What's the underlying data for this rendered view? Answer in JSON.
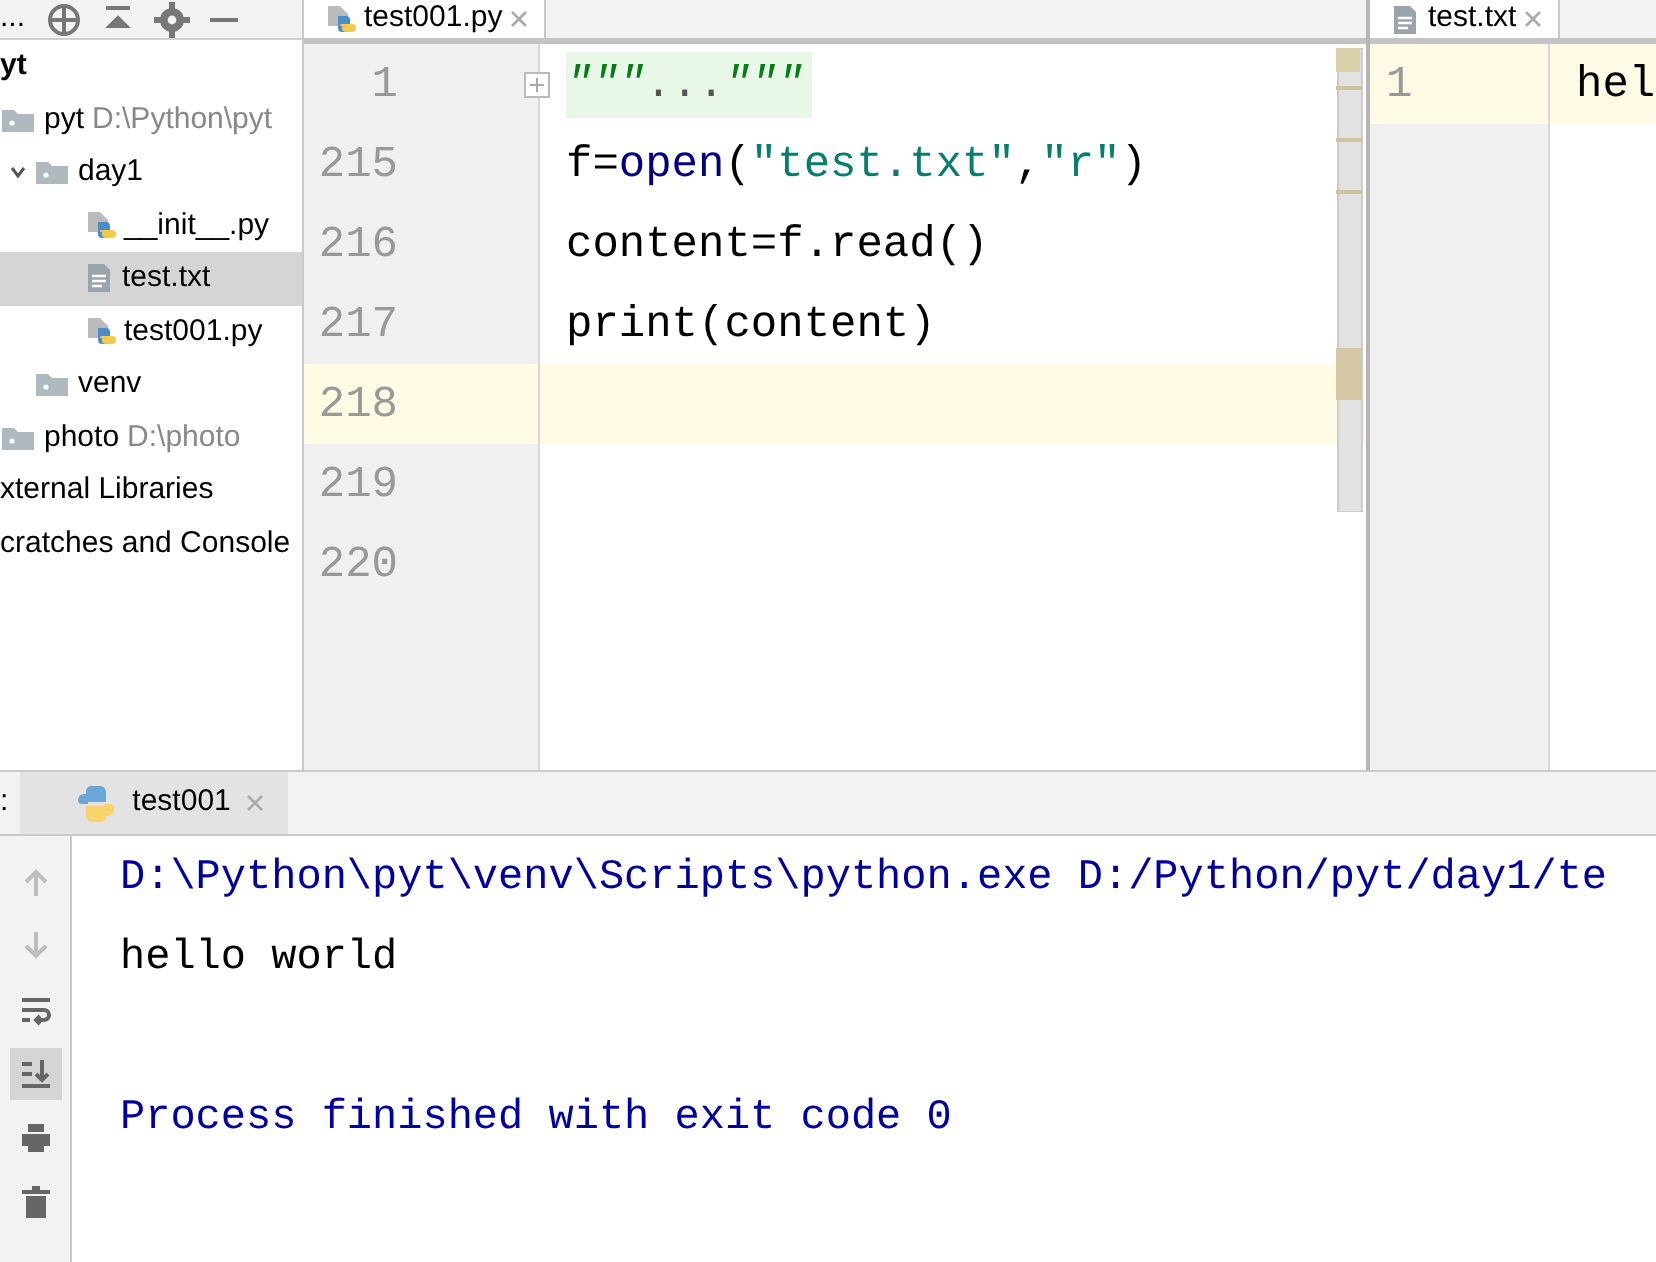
{
  "project_panel": {
    "toolbar_label": "...",
    "tree": [
      {
        "label": "yt",
        "kind": "header",
        "selected": false
      },
      {
        "label": "pyt",
        "path": "D:\\Python\\pyt",
        "kind": "folder",
        "selected": false,
        "children": [
          {
            "label": "day1",
            "kind": "folder",
            "selected": false,
            "children": [
              {
                "label": "__init__.py",
                "kind": "python",
                "selected": false
              },
              {
                "label": "test.txt",
                "kind": "text",
                "selected": true
              },
              {
                "label": "test001.py",
                "kind": "python",
                "selected": false
              }
            ]
          },
          {
            "label": "venv",
            "kind": "folder",
            "selected": false
          }
        ]
      },
      {
        "label": "photo",
        "path": "D:\\photo",
        "kind": "folder",
        "selected": false
      },
      {
        "label": "xternal Libraries",
        "kind": "plain",
        "selected": false
      },
      {
        "label": "cratches and Console",
        "kind": "plain",
        "selected": false
      }
    ]
  },
  "editor": {
    "tab": {
      "label": "test001.py",
      "kind": "python"
    },
    "lines": [
      {
        "number": "1",
        "folded": true,
        "current": false,
        "tokens": [
          {
            "text": "\"\"\"",
            "kind": "doc"
          },
          {
            "text": "...",
            "kind": "fold"
          },
          {
            "text": "\"\"\"",
            "kind": "doc"
          }
        ]
      },
      {
        "number": "215",
        "folded": false,
        "current": false,
        "tokens": [
          {
            "text": "f=",
            "kind": "plain"
          },
          {
            "text": "open",
            "kind": "builtin"
          },
          {
            "text": "(",
            "kind": "plain"
          },
          {
            "text": "\"test.txt\"",
            "kind": "string"
          },
          {
            "text": ",",
            "kind": "plain"
          },
          {
            "text": "\"r\"",
            "kind": "string"
          },
          {
            "text": ")",
            "kind": "plain"
          }
        ]
      },
      {
        "number": "216",
        "folded": false,
        "current": false,
        "tokens": [
          {
            "text": "content=f.read()",
            "kind": "plain"
          }
        ]
      },
      {
        "number": "217",
        "folded": false,
        "current": false,
        "tokens": [
          {
            "text": "print(content)",
            "kind": "plain"
          }
        ]
      },
      {
        "number": "218",
        "folded": false,
        "current": true
      },
      {
        "number": "219",
        "folded": false,
        "current": false
      },
      {
        "number": "220",
        "folded": false,
        "current": false
      }
    ]
  },
  "side_editor": {
    "tab": {
      "label": "test.txt",
      "kind": "text"
    },
    "lines": [
      {
        "number": "1",
        "text": "hel",
        "current": true
      }
    ]
  },
  "run_panel": {
    "label": ":",
    "tab": {
      "label": "test001"
    },
    "tools": [
      {
        "kind": "up",
        "disabled": true,
        "selected": false
      },
      {
        "kind": "down",
        "disabled": true,
        "selected": false
      },
      {
        "kind": "wrap",
        "disabled": false,
        "selected": false
      },
      {
        "kind": "scroll",
        "disabled": false,
        "selected": true
      },
      {
        "kind": "print",
        "disabled": false,
        "selected": false
      },
      {
        "kind": "trash",
        "disabled": false,
        "selected": false
      }
    ],
    "lines": [
      {
        "text": "D:\\Python\\pyt\\venv\\Scripts\\python.exe D:/Python/pyt/day1/te",
        "kind": "command"
      },
      {
        "text": "hello world",
        "kind": "output"
      },
      {
        "text": "Process finished with exit code 0",
        "kind": "exit"
      }
    ]
  }
}
